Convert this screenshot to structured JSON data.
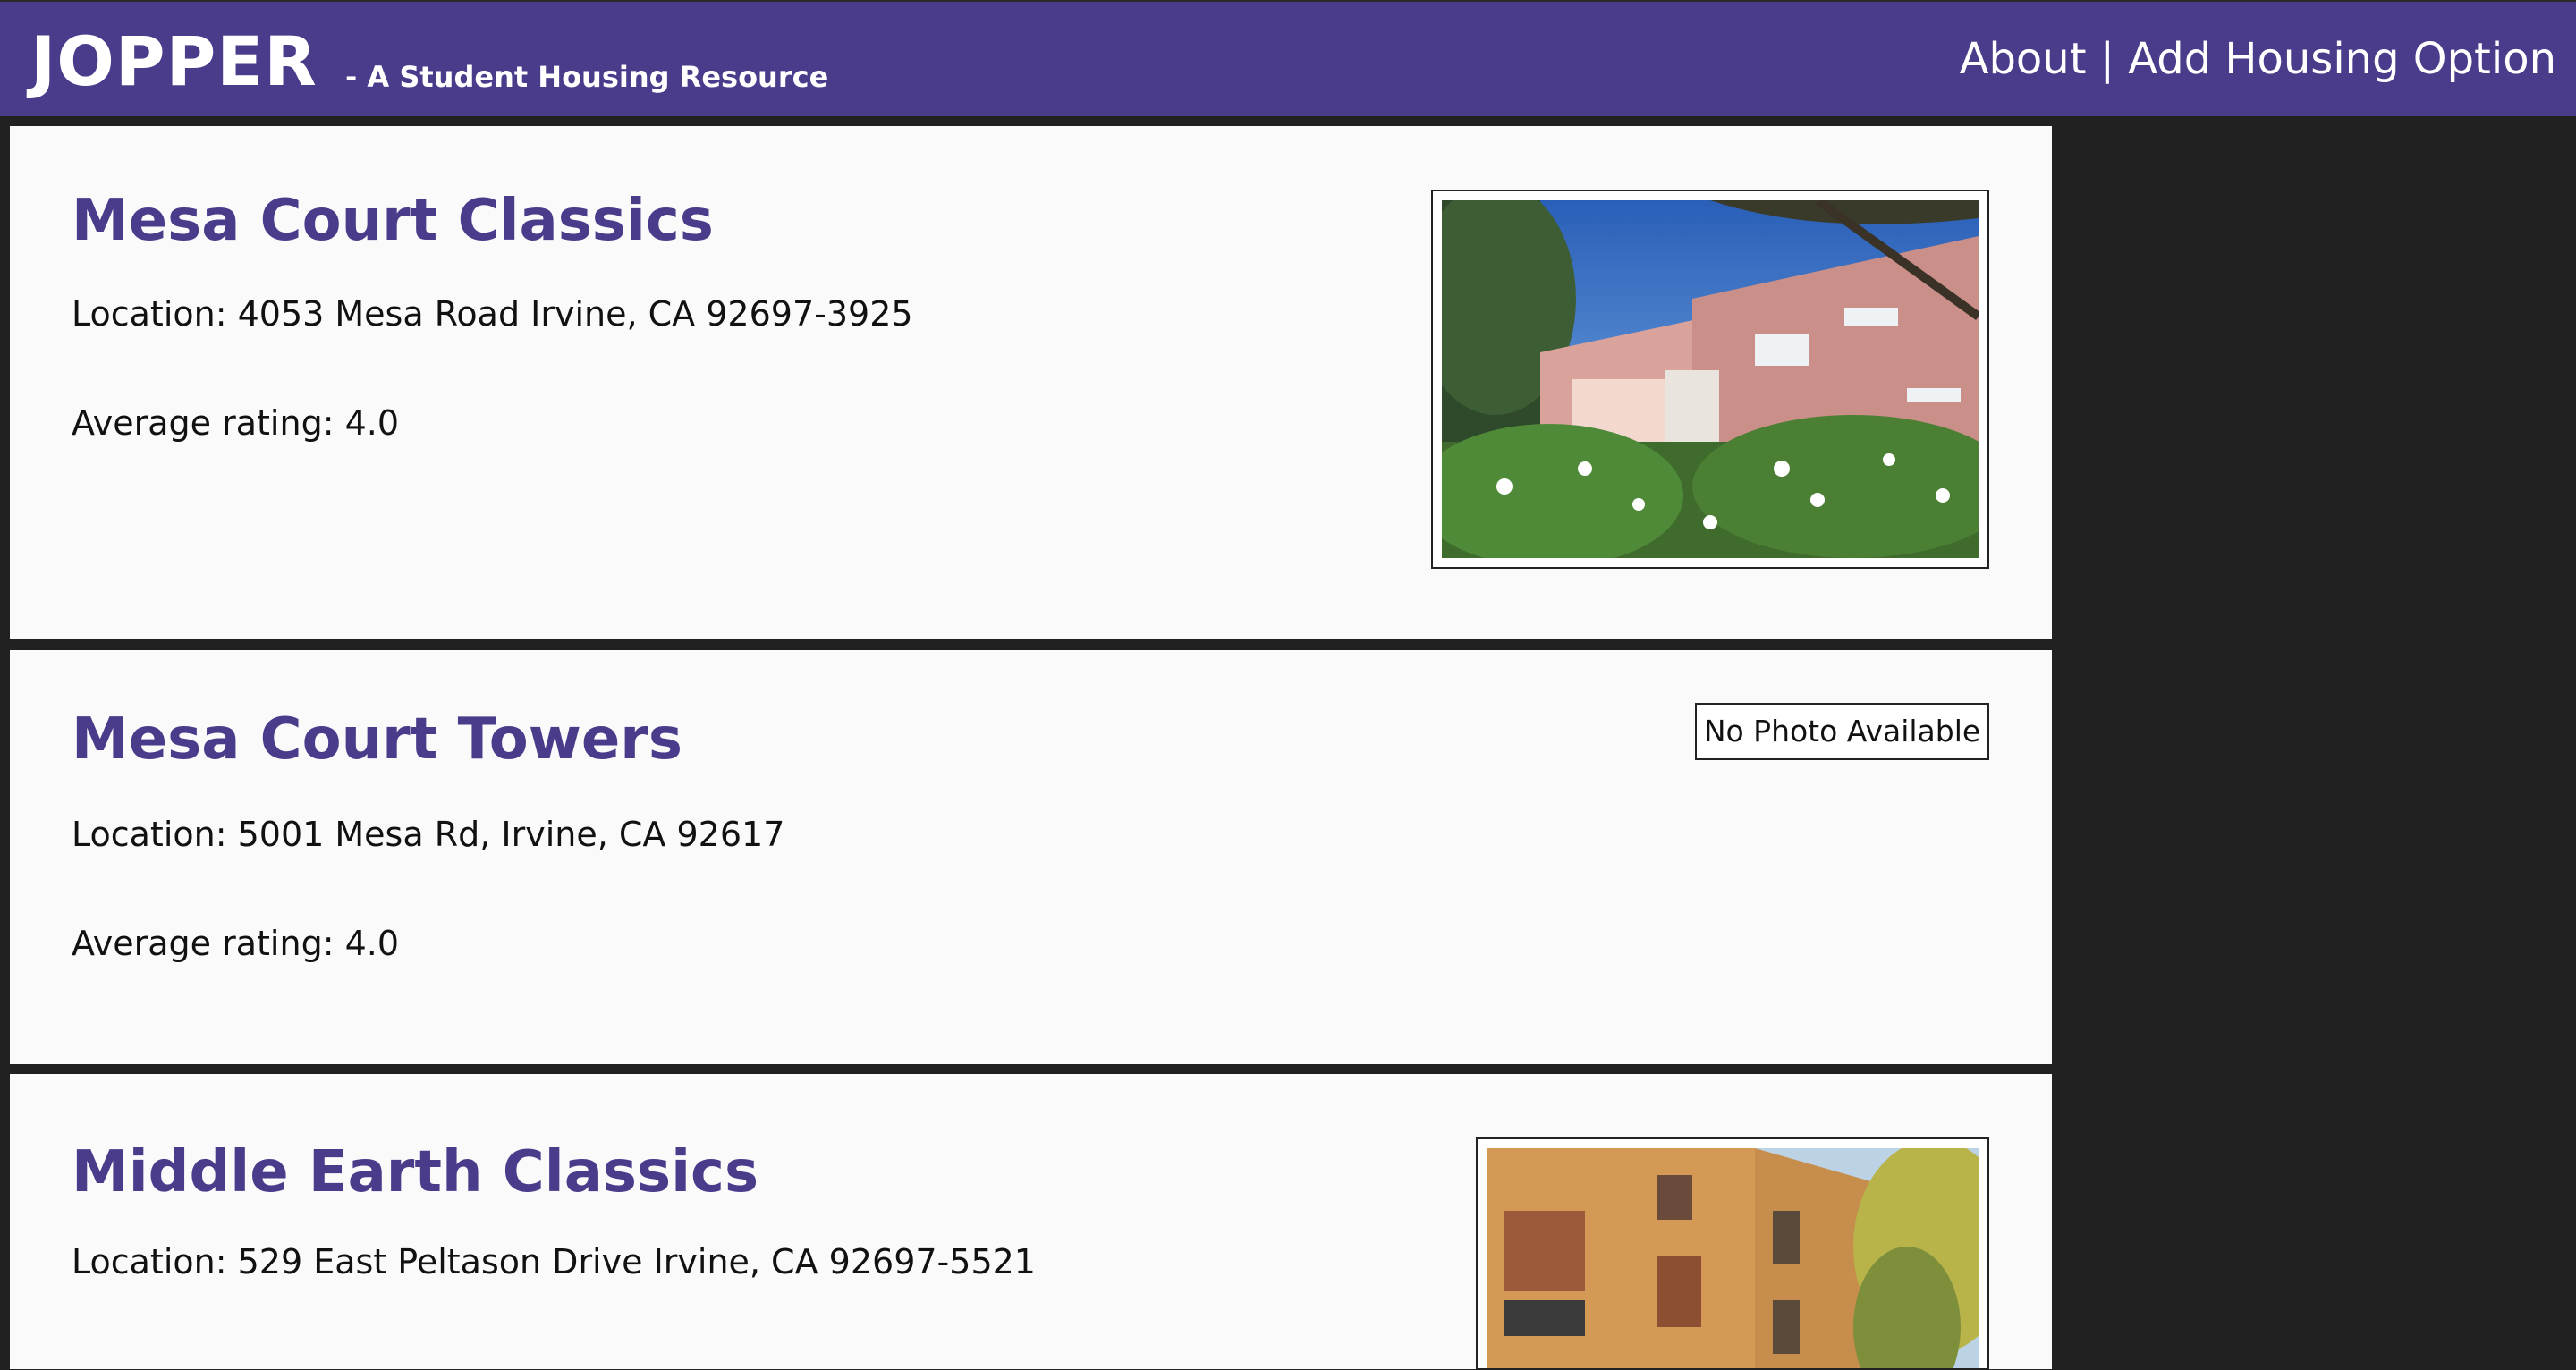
{
  "navbar": {
    "brand": "JOPPER",
    "tagline": "- A Student Housing Resource",
    "links": {
      "about": "About",
      "separator": "|",
      "add_housing": "Add Housing Option"
    }
  },
  "listings": [
    {
      "name": "Mesa Court Classics",
      "location": "Location: 4053 Mesa Road Irvine, CA 92697-3925",
      "rating": "Average rating: 4.0",
      "photo": "building-photo"
    },
    {
      "name": "Mesa Court Towers",
      "location": "Location: 5001 Mesa Rd, Irvine, CA 92617",
      "rating": "Average rating: 4.0",
      "photo_placeholder": "No Photo Available"
    },
    {
      "name": "Middle Earth Classics",
      "location": "Location: 529 East Peltason Drive Irvine, CA 92697-5521",
      "photo": "building-photo"
    }
  ],
  "colors": {
    "brand_purple": "#4b3b8b",
    "page_background": "#212121",
    "card_background": "#fafafa"
  }
}
